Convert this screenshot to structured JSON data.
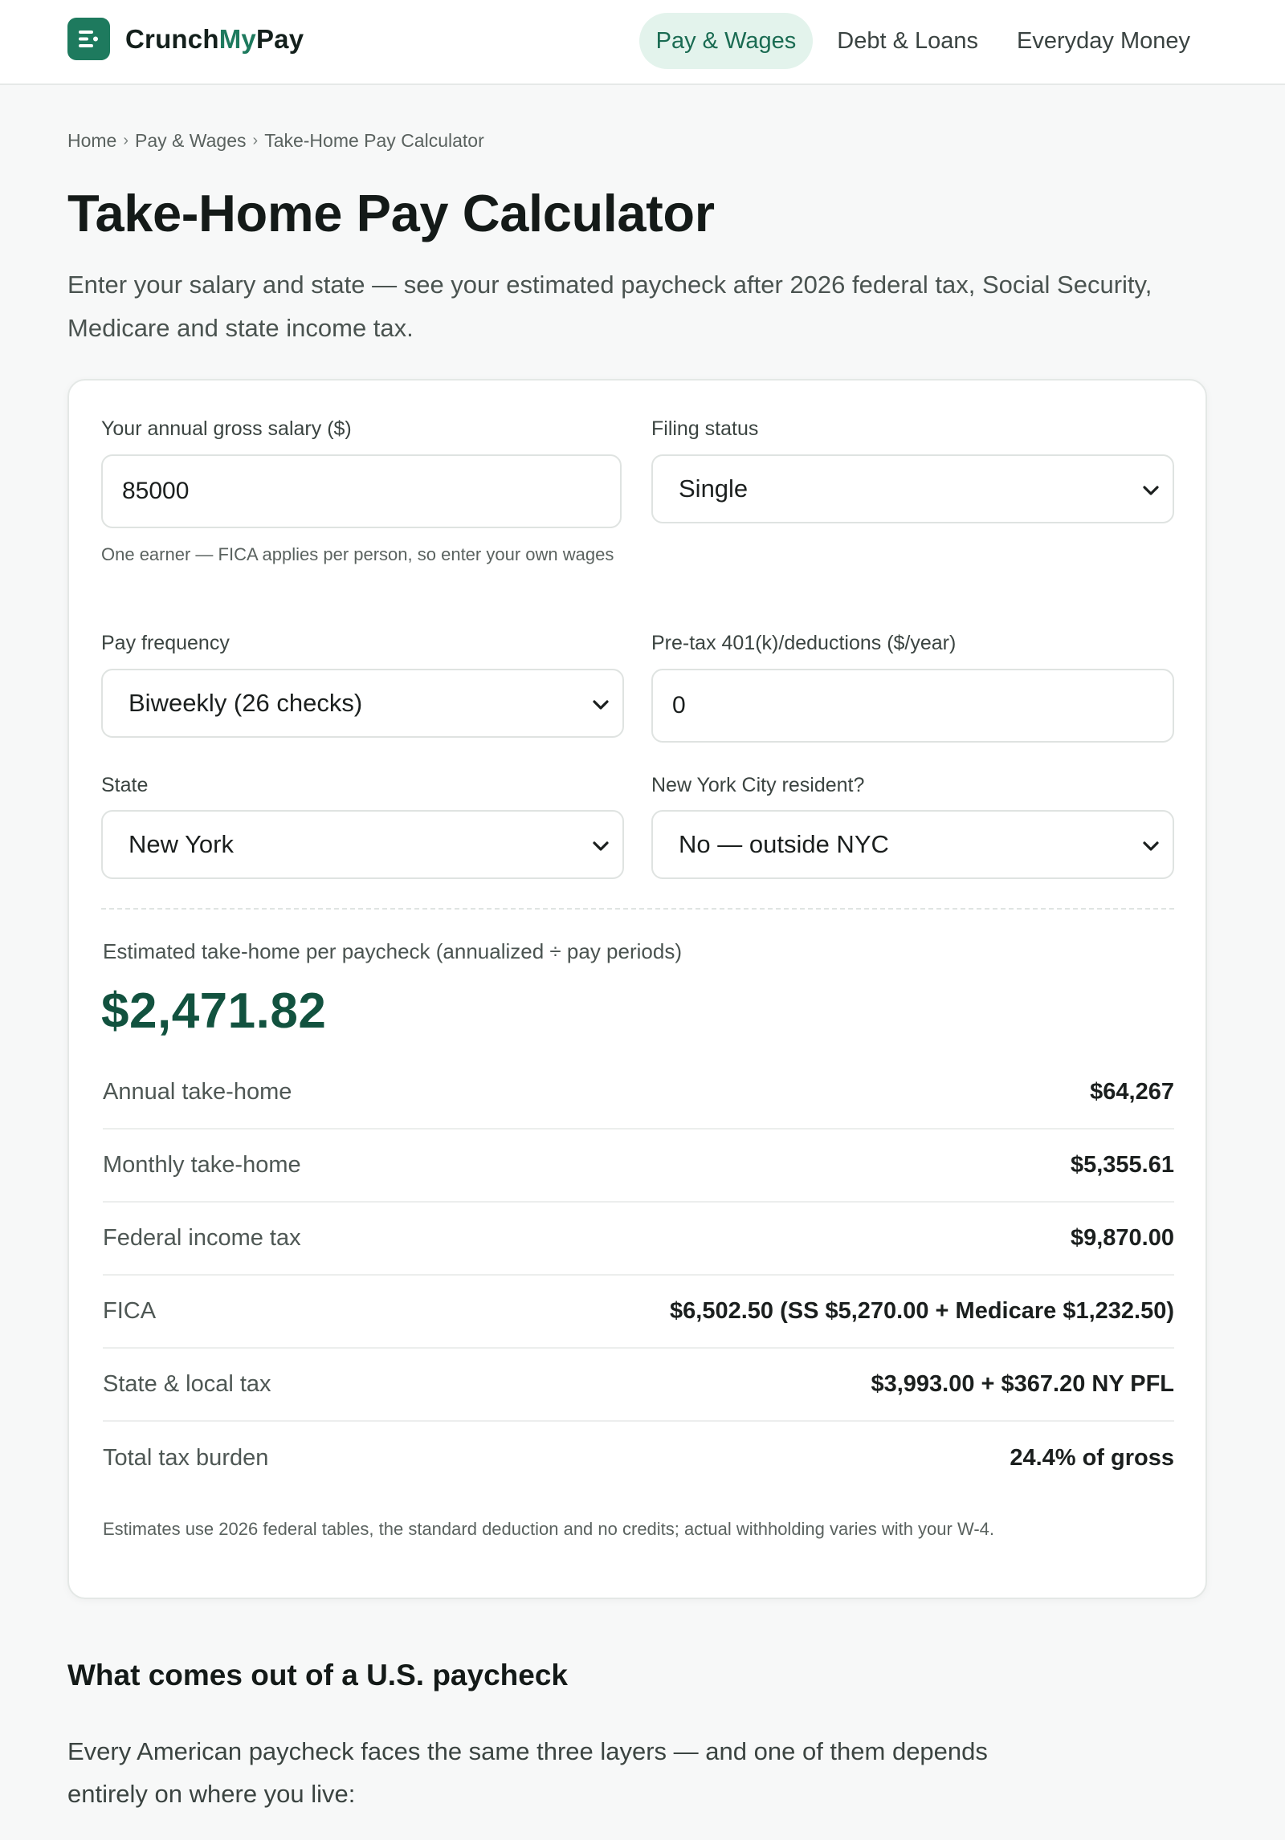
{
  "brand": {
    "name_main": "Crunch",
    "name_accent": "My",
    "name_end": "Pay",
    "accent_color": "#1e7a5e"
  },
  "nav": {
    "items": [
      {
        "label": "Pay & Wages",
        "active": true
      },
      {
        "label": "Debt & Loans",
        "active": false
      },
      {
        "label": "Everyday Money",
        "active": false
      }
    ]
  },
  "breadcrumb": {
    "home": "Home",
    "section": "Pay & Wages",
    "current": "Take-Home Pay Calculator"
  },
  "page": {
    "title": "Take-Home Pay Calculator",
    "lede": "Enter your salary and state — see your estimated paycheck after 2026 federal tax, Social Security, Medicare and state income tax."
  },
  "form": {
    "salary": {
      "label": "Your annual gross salary ($)",
      "value": "85000",
      "hint": "One earner — FICA applies per person, so enter your own wages"
    },
    "filing_status": {
      "label": "Filing status",
      "value": "Single"
    },
    "pay_frequency": {
      "label": "Pay frequency",
      "value": "Biweekly (26 checks)"
    },
    "pretax": {
      "label": "Pre-tax 401(k)/deductions ($/year)",
      "value": "0"
    },
    "state": {
      "label": "State",
      "value": "New York"
    },
    "nyc_resident": {
      "label": "New York City resident?",
      "value": "No — outside NYC"
    }
  },
  "results": {
    "headline_label": "Estimated take-home per paycheck (annualized ÷ pay periods)",
    "headline_value": "$2,471.82",
    "rows": [
      {
        "label": "Annual take-home",
        "value": "$64,267"
      },
      {
        "label": "Monthly take-home",
        "value": "$5,355.61"
      },
      {
        "label": "Federal income tax",
        "value": "$9,870.00"
      },
      {
        "label": "FICA",
        "value": "$6,502.50 (SS $5,270.00 + Medicare $1,232.50)"
      },
      {
        "label": "State & local tax",
        "value": "$3,993.00 + $367.20 NY PFL"
      },
      {
        "label": "Total tax burden",
        "value": "24.4% of gross"
      }
    ],
    "footnote": "Estimates use 2026 federal tables, the standard deduction and no credits; actual withholding varies with your W-4."
  },
  "section": {
    "title": "What comes out of a U.S. paycheck",
    "body": "Every American paycheck faces the same three layers — and one of them depends entirely on where you live:"
  }
}
